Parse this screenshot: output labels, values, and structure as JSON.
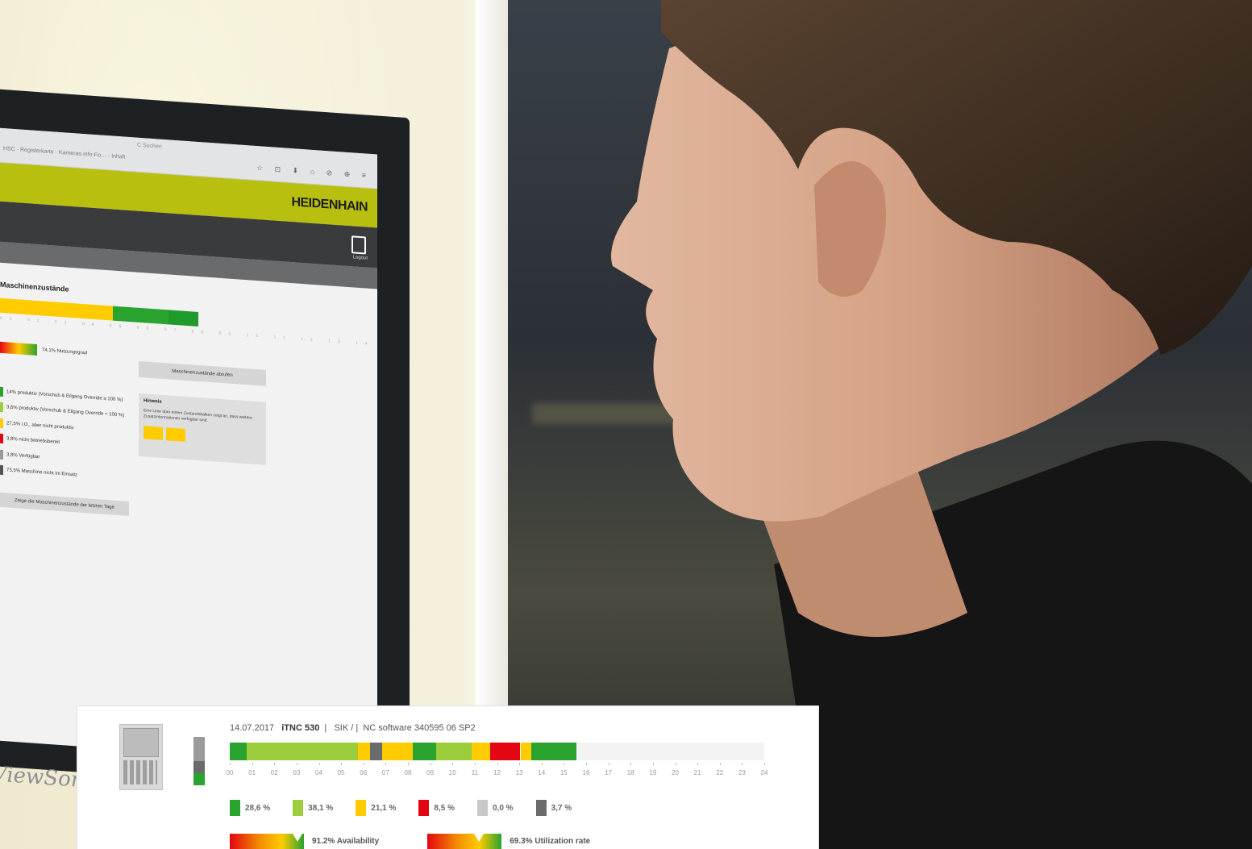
{
  "monitor": {
    "brand": "ViewSonic",
    "browser": {
      "tabs": "HSC · Registerkarte · Kameras·info·Fo… · Inhalt",
      "address": "C  Suchen",
      "icons": "☆ ⊡ ⬇ ⌂ ⊘ ⊕ ≡"
    },
    "app": {
      "logo": "HEIDENHAIN",
      "nav_icon_label": "Logout",
      "section_title": "Maschinenzustände",
      "kpi_label": "74,1% Nutzungsgrad",
      "button_states": "Maschinenzustände abrufen",
      "note_title": "Hinweis",
      "note_body": "Eine Linie über einem Zustandsbalken zeigt an, dass weitere Zusatzinformationen verfügbar sind.",
      "legend": [
        {
          "text": "14%  produktiv (Vorschub & Eilgang Override ≥ 100 %)",
          "color": "#2ba32f"
        },
        {
          "text": "3,6%  produktiv (Vorschub & Eilgang Override < 100 %)",
          "color": "#9ccd3c"
        },
        {
          "text": "27,5%  i.O., aber nicht produktiv",
          "color": "#ffcc00"
        },
        {
          "text": "3,8%  nicht betriebsbereit",
          "color": "#e30613"
        },
        {
          "text": "3,8%  Verfügbar",
          "color": "#9a9a9a"
        },
        {
          "text": "73,5%  Maschine nicht im Einsatz",
          "color": "#555555"
        }
      ],
      "prev_button": "Zeige die Maschinenzustände der letzten Tage",
      "state_bar": [
        {
          "color": "#ffcc00",
          "share": 0.57
        },
        {
          "color": "#2ba32f",
          "share": 0.28
        },
        {
          "color": "#1f9a2c",
          "share": 0.15
        }
      ],
      "ticks": "01 02 03 04 05 06 07 08 09 10 11 12 13 14 15 16 17 18 19 20 21 22 23 24"
    }
  },
  "panel": {
    "date": "14.07.2017",
    "control": "iTNC 530",
    "sik": "SIK  /  |",
    "nc_software": "NC software  340595 06 SP2",
    "stack_colors": [
      "#9a9a9a",
      "#9a9a9a",
      "#6b6b6b",
      "#2ba32f"
    ],
    "timeline": [
      {
        "start": 0.0,
        "end": 0.75,
        "color": "#2ba32f"
      },
      {
        "start": 0.75,
        "end": 5.75,
        "color": "#9ccd3c"
      },
      {
        "start": 5.75,
        "end": 6.3,
        "color": "#ffcc00"
      },
      {
        "start": 6.3,
        "end": 6.85,
        "color": "#6b6b6b"
      },
      {
        "start": 6.85,
        "end": 8.2,
        "color": "#ffcc00"
      },
      {
        "start": 8.2,
        "end": 9.25,
        "color": "#2ba32f"
      },
      {
        "start": 9.25,
        "end": 10.85,
        "color": "#9ccd3c"
      },
      {
        "start": 10.85,
        "end": 11.7,
        "color": "#ffcc00"
      },
      {
        "start": 11.7,
        "end": 13.05,
        "color": "#e30613"
      },
      {
        "start": 13.05,
        "end": 13.55,
        "color": "#ffcc00"
      },
      {
        "start": 13.55,
        "end": 15.55,
        "color": "#2ba32f"
      }
    ],
    "hours": [
      "00",
      "01",
      "02",
      "03",
      "04",
      "05",
      "06",
      "07",
      "08",
      "09",
      "10",
      "11",
      "12",
      "13",
      "14",
      "15",
      "16",
      "17",
      "18",
      "19",
      "20",
      "21",
      "22",
      "23",
      "24"
    ],
    "percentages": [
      {
        "value": "28,6 %",
        "color": "#2ba32f"
      },
      {
        "value": "38,1 %",
        "color": "#9ccd3c"
      },
      {
        "value": "21,1 %",
        "color": "#ffcc00"
      },
      {
        "value": "8,5 %",
        "color": "#e30613"
      },
      {
        "value": "0,0 %",
        "color": "#c7c7c7"
      },
      {
        "value": "3,7 %",
        "color": "#6b6b6b"
      }
    ],
    "kpis": [
      {
        "label": "91.2% Availability",
        "marker": 0.91
      },
      {
        "label": "69.3% Utilization rate",
        "marker": 0.69
      }
    ]
  }
}
